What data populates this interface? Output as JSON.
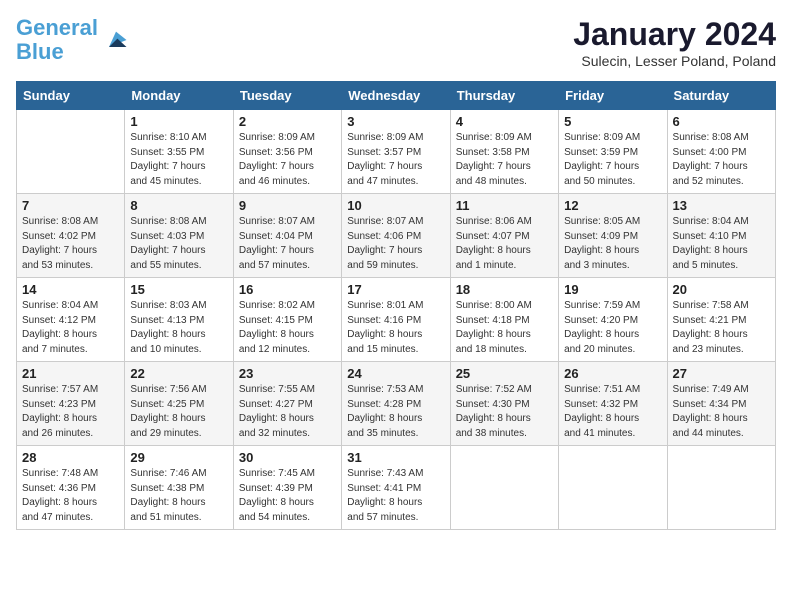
{
  "header": {
    "logo_line1": "General",
    "logo_line2": "Blue",
    "month": "January 2024",
    "location": "Sulecin, Lesser Poland, Poland"
  },
  "days_of_week": [
    "Sunday",
    "Monday",
    "Tuesday",
    "Wednesday",
    "Thursday",
    "Friday",
    "Saturday"
  ],
  "weeks": [
    [
      {
        "day": "",
        "info": ""
      },
      {
        "day": "1",
        "info": "Sunrise: 8:10 AM\nSunset: 3:55 PM\nDaylight: 7 hours\nand 45 minutes."
      },
      {
        "day": "2",
        "info": "Sunrise: 8:09 AM\nSunset: 3:56 PM\nDaylight: 7 hours\nand 46 minutes."
      },
      {
        "day": "3",
        "info": "Sunrise: 8:09 AM\nSunset: 3:57 PM\nDaylight: 7 hours\nand 47 minutes."
      },
      {
        "day": "4",
        "info": "Sunrise: 8:09 AM\nSunset: 3:58 PM\nDaylight: 7 hours\nand 48 minutes."
      },
      {
        "day": "5",
        "info": "Sunrise: 8:09 AM\nSunset: 3:59 PM\nDaylight: 7 hours\nand 50 minutes."
      },
      {
        "day": "6",
        "info": "Sunrise: 8:08 AM\nSunset: 4:00 PM\nDaylight: 7 hours\nand 52 minutes."
      }
    ],
    [
      {
        "day": "7",
        "info": "Sunrise: 8:08 AM\nSunset: 4:02 PM\nDaylight: 7 hours\nand 53 minutes."
      },
      {
        "day": "8",
        "info": "Sunrise: 8:08 AM\nSunset: 4:03 PM\nDaylight: 7 hours\nand 55 minutes."
      },
      {
        "day": "9",
        "info": "Sunrise: 8:07 AM\nSunset: 4:04 PM\nDaylight: 7 hours\nand 57 minutes."
      },
      {
        "day": "10",
        "info": "Sunrise: 8:07 AM\nSunset: 4:06 PM\nDaylight: 7 hours\nand 59 minutes."
      },
      {
        "day": "11",
        "info": "Sunrise: 8:06 AM\nSunset: 4:07 PM\nDaylight: 8 hours\nand 1 minute."
      },
      {
        "day": "12",
        "info": "Sunrise: 8:05 AM\nSunset: 4:09 PM\nDaylight: 8 hours\nand 3 minutes."
      },
      {
        "day": "13",
        "info": "Sunrise: 8:04 AM\nSunset: 4:10 PM\nDaylight: 8 hours\nand 5 minutes."
      }
    ],
    [
      {
        "day": "14",
        "info": "Sunrise: 8:04 AM\nSunset: 4:12 PM\nDaylight: 8 hours\nand 7 minutes."
      },
      {
        "day": "15",
        "info": "Sunrise: 8:03 AM\nSunset: 4:13 PM\nDaylight: 8 hours\nand 10 minutes."
      },
      {
        "day": "16",
        "info": "Sunrise: 8:02 AM\nSunset: 4:15 PM\nDaylight: 8 hours\nand 12 minutes."
      },
      {
        "day": "17",
        "info": "Sunrise: 8:01 AM\nSunset: 4:16 PM\nDaylight: 8 hours\nand 15 minutes."
      },
      {
        "day": "18",
        "info": "Sunrise: 8:00 AM\nSunset: 4:18 PM\nDaylight: 8 hours\nand 18 minutes."
      },
      {
        "day": "19",
        "info": "Sunrise: 7:59 AM\nSunset: 4:20 PM\nDaylight: 8 hours\nand 20 minutes."
      },
      {
        "day": "20",
        "info": "Sunrise: 7:58 AM\nSunset: 4:21 PM\nDaylight: 8 hours\nand 23 minutes."
      }
    ],
    [
      {
        "day": "21",
        "info": "Sunrise: 7:57 AM\nSunset: 4:23 PM\nDaylight: 8 hours\nand 26 minutes."
      },
      {
        "day": "22",
        "info": "Sunrise: 7:56 AM\nSunset: 4:25 PM\nDaylight: 8 hours\nand 29 minutes."
      },
      {
        "day": "23",
        "info": "Sunrise: 7:55 AM\nSunset: 4:27 PM\nDaylight: 8 hours\nand 32 minutes."
      },
      {
        "day": "24",
        "info": "Sunrise: 7:53 AM\nSunset: 4:28 PM\nDaylight: 8 hours\nand 35 minutes."
      },
      {
        "day": "25",
        "info": "Sunrise: 7:52 AM\nSunset: 4:30 PM\nDaylight: 8 hours\nand 38 minutes."
      },
      {
        "day": "26",
        "info": "Sunrise: 7:51 AM\nSunset: 4:32 PM\nDaylight: 8 hours\nand 41 minutes."
      },
      {
        "day": "27",
        "info": "Sunrise: 7:49 AM\nSunset: 4:34 PM\nDaylight: 8 hours\nand 44 minutes."
      }
    ],
    [
      {
        "day": "28",
        "info": "Sunrise: 7:48 AM\nSunset: 4:36 PM\nDaylight: 8 hours\nand 47 minutes."
      },
      {
        "day": "29",
        "info": "Sunrise: 7:46 AM\nSunset: 4:38 PM\nDaylight: 8 hours\nand 51 minutes."
      },
      {
        "day": "30",
        "info": "Sunrise: 7:45 AM\nSunset: 4:39 PM\nDaylight: 8 hours\nand 54 minutes."
      },
      {
        "day": "31",
        "info": "Sunrise: 7:43 AM\nSunset: 4:41 PM\nDaylight: 8 hours\nand 57 minutes."
      },
      {
        "day": "",
        "info": ""
      },
      {
        "day": "",
        "info": ""
      },
      {
        "day": "",
        "info": ""
      }
    ]
  ]
}
